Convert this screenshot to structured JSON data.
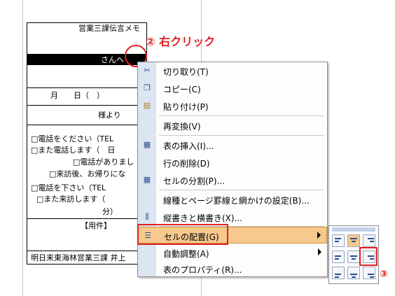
{
  "document": {
    "title": "営業三課伝言メモ",
    "recipient": "さんへ",
    "date_line": "月　　日（　）",
    "from_line": "様より",
    "lines": [
      "□電話をください（TEL",
      "□また電話します（　日",
      "□電話がありまし",
      "□来訪後、お帰りにな",
      "□電話を下さい（TEL",
      "□また来訪します（",
      "分）",
      "【用件】",
      "明日来東海林営業三課 井上"
    ]
  },
  "annotations": {
    "step2": "② 右クリック",
    "step3": "③"
  },
  "context_menu": {
    "items": [
      {
        "label": "切り取り(T)",
        "icon": "scissors-icon"
      },
      {
        "label": "コピー(C)",
        "icon": "copy-icon"
      },
      {
        "label": "貼り付け(P)",
        "icon": "paste-icon"
      },
      {
        "label": "再変換(V)",
        "icon": ""
      },
      {
        "label": "表の挿入(I)...",
        "icon": "insert-table-icon"
      },
      {
        "label": "行の削除(D)",
        "icon": ""
      },
      {
        "label": "セルの分割(P)...",
        "icon": "split-cells-icon"
      },
      {
        "label": "線種とページ罫線と網かけの設定(B)...",
        "icon": ""
      },
      {
        "label": "縦書きと横書き(X)...",
        "icon": "text-direction-icon"
      },
      {
        "label": "セルの配置(G)",
        "icon": "cell-alignment-icon",
        "submenu": true
      },
      {
        "label": "自動調整(A)",
        "icon": "",
        "submenu": true
      },
      {
        "label": "表のプロパティ(R)...",
        "icon": ""
      }
    ]
  },
  "colors": {
    "annotation": "#e02020",
    "highlight": "#f7c98d",
    "icon_strip": "#dde5f2"
  }
}
